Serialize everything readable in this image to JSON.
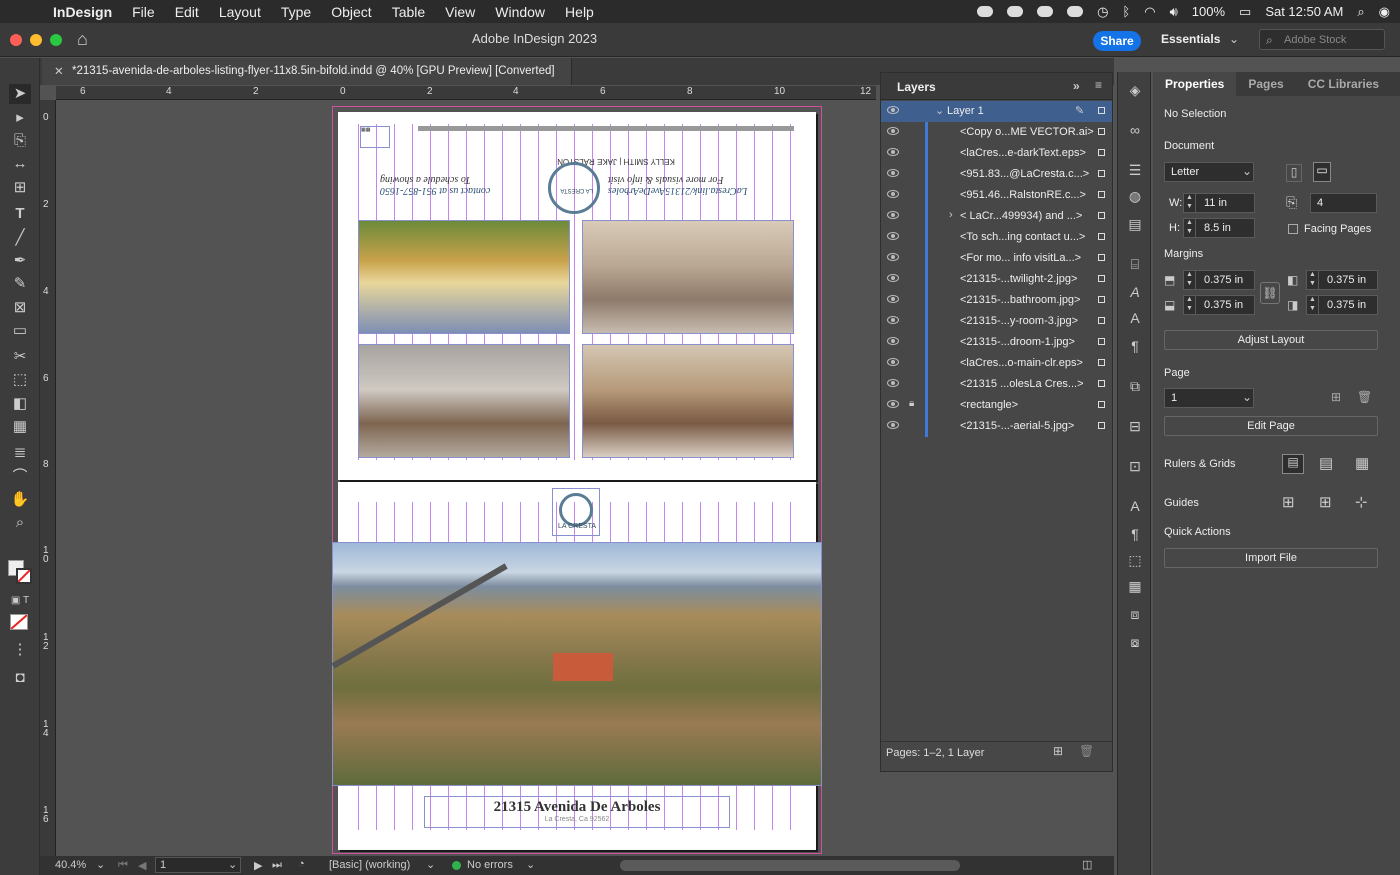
{
  "menubar": {
    "app_name": "InDesign",
    "items": [
      "File",
      "Edit",
      "Layout",
      "Type",
      "Object",
      "Table",
      "View",
      "Window",
      "Help"
    ],
    "battery": "100%",
    "clock": "Sat 12:50 AM"
  },
  "titlebar": {
    "title": "Adobe InDesign 2023",
    "share_label": "Share",
    "workspace_label": "Essentials",
    "search_placeholder": "Adobe Stock"
  },
  "document_tab": {
    "label": "*21315-avenida-de-arboles-listing-flyer-11x8.5in-bifold.indd @ 40% [GPU Preview] [Converted]"
  },
  "rulers": {
    "horizontal": [
      "6",
      "4",
      "2",
      "0",
      "2",
      "4",
      "6",
      "8",
      "10",
      "12"
    ],
    "vertical": [
      "0",
      "2",
      "4",
      "6",
      "8",
      "1\n0",
      "1\n2",
      "1\n4",
      "1\n6"
    ]
  },
  "flyer": {
    "top_script_1": "LaCresta.link/21315AveDeArboles",
    "top_script_2": "For more visuals & info visit",
    "top_script_3": "contact us at 951-857-1650",
    "top_script_4": "To schedule a showing",
    "agent_1": "KELLY SMITH",
    "agent_2": "JAKE RALSTON",
    "logo_text": "LA CRESTA",
    "address": "21315 Avenida De Arboles",
    "city": "La Cresta, Ca 92562"
  },
  "statusbar": {
    "zoom": "40.4%",
    "page": "1",
    "style": "[Basic] (working)",
    "errors": "No errors"
  },
  "layers_panel": {
    "title": "Layers",
    "layer_name": "Layer 1",
    "items": [
      "<Copy o...ME VECTOR.ai>",
      "<laCres...e-darkText.eps>",
      "<951.83...@LaCresta.c...>",
      "<951.46...RalstonRE.c...>",
      "<  LaCr...499934) and ...>",
      "<To sch...ing contact u...>",
      "<For mo... info visitLa...>",
      "<21315-...twilight-2.jpg>",
      "<21315-...bathroom.jpg>",
      "<21315-...y-room-3.jpg>",
      "<21315-...droom-1.jpg>",
      "<laCres...o-main-clr.eps>",
      "<21315 ...olesLa Cres...>",
      "<rectangle>",
      "<21315-...-aerial-5.jpg>"
    ],
    "footer": "Pages: 1–2, 1 Layer"
  },
  "properties": {
    "tabs": [
      "Properties",
      "Pages",
      "CC Libraries"
    ],
    "selection": "No Selection",
    "document_label": "Document",
    "size_preset": "Letter",
    "width_label": "W:",
    "width": "11 in",
    "height_label": "H:",
    "height": "8.5 in",
    "pages_count": "4",
    "facing_pages": "Facing Pages",
    "margins_label": "Margins",
    "margin_top": "0.375 in",
    "margin_bottom": "0.375 in",
    "margin_left": "0.375 in",
    "margin_right": "0.375 in",
    "adjust_layout": "Adjust Layout",
    "page_label": "Page",
    "page_value": "1",
    "edit_page": "Edit Page",
    "rulers_grids": "Rulers & Grids",
    "guides": "Guides",
    "quick_actions": "Quick Actions",
    "import_file": "Import File"
  },
  "colors": {
    "accent": "#1473e6",
    "layer_color": "#3f7bd6",
    "guide": "#b25be8"
  }
}
